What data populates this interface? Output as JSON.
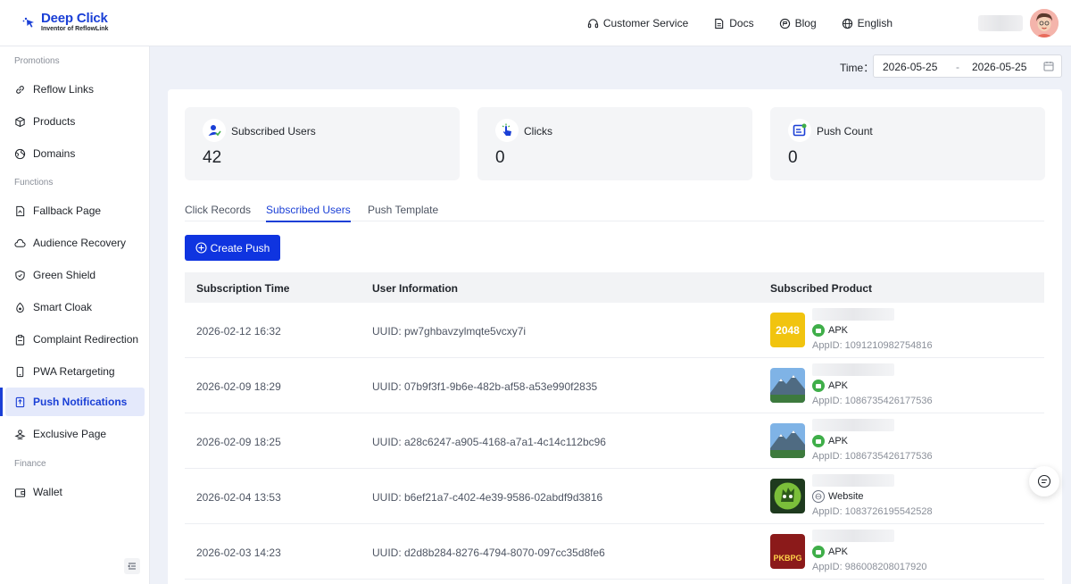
{
  "brand": {
    "name": "Deep Click",
    "tagline": "Inventor of ReflowLink",
    "accent": "#1a3fd6"
  },
  "topnav": [
    {
      "label": "Customer Service",
      "icon": "headset-icon"
    },
    {
      "label": "Docs",
      "icon": "document-icon"
    },
    {
      "label": "Blog",
      "icon": "blog-icon"
    },
    {
      "label": "English",
      "icon": "globe-icon"
    }
  ],
  "sidebar": {
    "sections": [
      {
        "title": "Promotions"
      },
      {
        "title": "Functions"
      },
      {
        "title": "Finance"
      }
    ],
    "items": [
      {
        "label": "Reflow Links",
        "icon": "link-icon"
      },
      {
        "label": "Products",
        "icon": "cube-icon"
      },
      {
        "label": "Domains",
        "icon": "globe-icon"
      },
      {
        "label": "Fallback Page",
        "icon": "page-icon"
      },
      {
        "label": "Audience Recovery",
        "icon": "cloud-icon"
      },
      {
        "label": "Green Shield",
        "icon": "shield-icon"
      },
      {
        "label": "Smart Cloak",
        "icon": "cloak-icon"
      },
      {
        "label": "Complaint Redirection",
        "icon": "clipboard-icon"
      },
      {
        "label": "PWA Retargeting",
        "icon": "phone-icon"
      },
      {
        "label": "Push Notifications",
        "icon": "push-icon",
        "active": true
      },
      {
        "label": "Exclusive Page",
        "icon": "exclusive-icon"
      },
      {
        "label": "Wallet",
        "icon": "wallet-icon"
      }
    ]
  },
  "filter": {
    "time_label": "Time：",
    "start": "2026-05-25",
    "separator": "-",
    "end": "2026-05-25"
  },
  "stats": [
    {
      "label": "Subscribed Users",
      "value": "42",
      "icon": "user-check-icon"
    },
    {
      "label": "Clicks",
      "value": "0",
      "icon": "click-icon"
    },
    {
      "label": "Push Count",
      "value": "0",
      "icon": "push-count-icon"
    }
  ],
  "tabs": [
    {
      "label": "Click Records"
    },
    {
      "label": "Subscribed Users",
      "active": true
    },
    {
      "label": "Push Template"
    }
  ],
  "create_button": "Create Push",
  "table": {
    "headers": [
      "Subscription Time",
      "User Information",
      "Subscribed Product"
    ],
    "rows": [
      {
        "time": "2026-02-12 16:32",
        "user": "UUID: pw7ghbavzylmqte5vcxy7i",
        "type": "APK",
        "appid": "AppID: 1091210982754816",
        "thumb": "2048",
        "thumb_text": "2048"
      },
      {
        "time": "2026-02-09 18:29",
        "user": "UUID: 07b9f3f1-9b6e-482b-af58-a53e990f2835",
        "type": "APK",
        "appid": "AppID: 1086735426177536",
        "thumb": "mountain"
      },
      {
        "time": "2026-02-09 18:25",
        "user": "UUID: a28c6247-a905-4168-a7a1-4c14c112bc96",
        "type": "APK",
        "appid": "AppID: 1086735426177536",
        "thumb": "mountain"
      },
      {
        "time": "2026-02-04 13:53",
        "user": "UUID: b6ef21a7-c402-4e39-9586-02abdf9d3816",
        "type": "Website",
        "appid": "AppID: 1083726195542528",
        "thumb": "zombie"
      },
      {
        "time": "2026-02-03 14:23",
        "user": "UUID: d2d8b284-8276-4794-8070-097cc35d8fe6",
        "type": "APK",
        "appid": "AppID: 986008208017920",
        "thumb": "pkbpg",
        "thumb_text": "PKBPG"
      }
    ]
  }
}
